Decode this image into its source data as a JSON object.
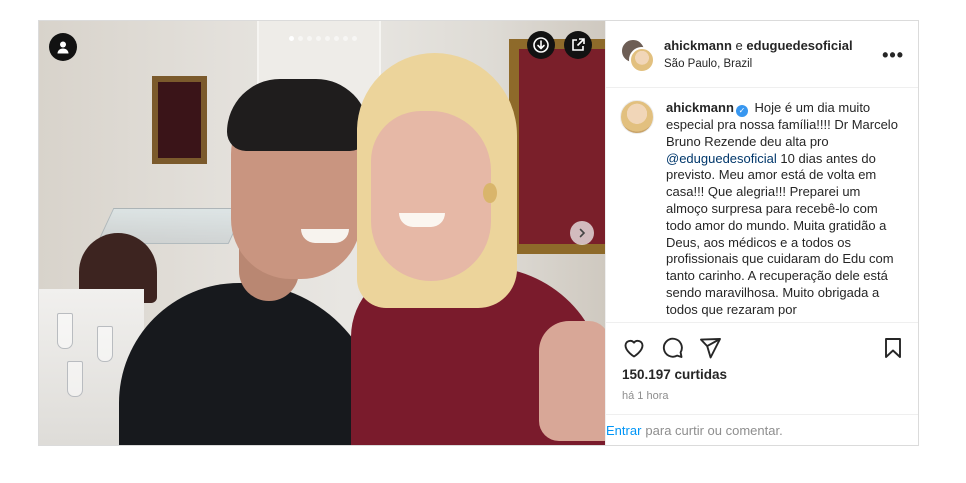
{
  "header": {
    "user1": "ahickmann",
    "separator": "e",
    "user2": "eduguedesoficial",
    "location": "São Paulo, Brazil",
    "more_label": "•••"
  },
  "caption": {
    "username": "ahickmann",
    "verified_icon": "check-icon",
    "text_part1": "Hoje é um dia muito especial pra nossa família!!!! Dr Marcelo Bruno Rezende deu alta pro",
    "mention": "@eduguedesoficial",
    "text_part2": "10 dias antes do previsto. Meu amor está de volta em casa!!! Que alegria!!! Preparei um almoço surpresa para recebê-lo com todo amor do mundo. Muita gratidão a Deus, aos médicos e a todos os profissionais que cuidaram do Edu com tanto carinho. A recuperação dele está sendo maravilhosa. Muito obrigada a todos que rezaram por"
  },
  "stats": {
    "likes": "150.197 curtidas",
    "time": "há 1 hora"
  },
  "comment": {
    "login_link": "Entrar",
    "prompt": "para curtir ou comentar."
  },
  "media": {
    "carousel_count": 8,
    "carousel_active": 0
  },
  "icons": {
    "user_tag": "user-icon",
    "download": "download-icon",
    "share": "external-link-icon",
    "next": "chevron-right-icon",
    "like": "heart-icon",
    "comment": "comment-icon",
    "send": "send-icon",
    "save": "bookmark-icon"
  }
}
